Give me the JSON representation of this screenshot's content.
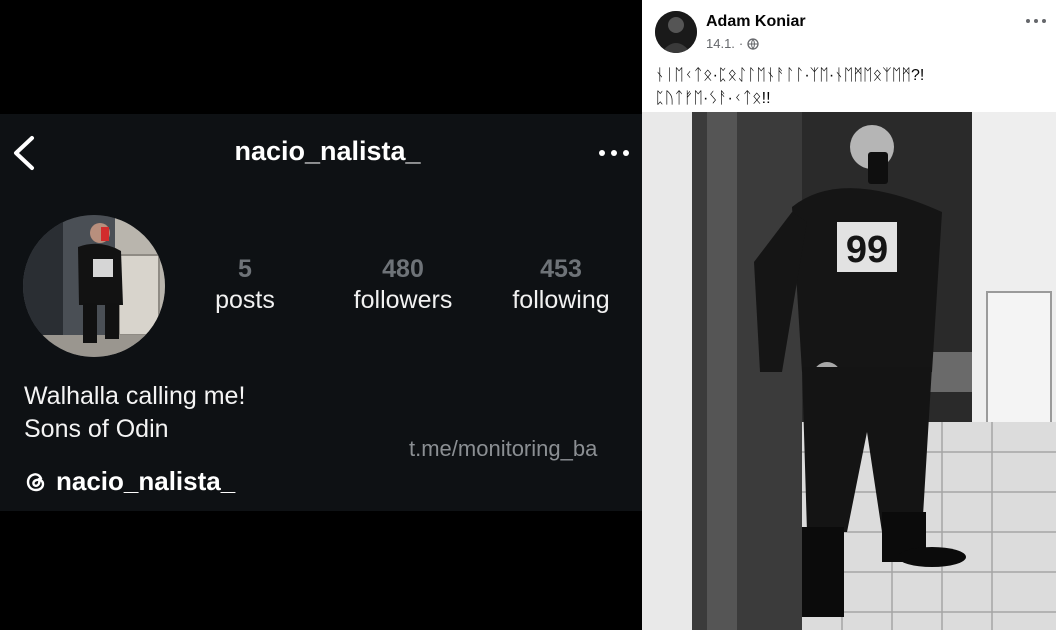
{
  "instagram": {
    "username": "nacio_nalista_",
    "stats": [
      {
        "value": "5",
        "label": "posts"
      },
      {
        "value": "480",
        "label": "followers"
      },
      {
        "value": "453",
        "label": "following"
      }
    ],
    "bio_lines": [
      "Walhalla calling me!",
      "Sons of Odin"
    ],
    "threads_handle": "nacio_nalista_",
    "watermark": "t.me/monitoring_ba"
  },
  "facebook": {
    "author": "Adam Koniar",
    "date": "14.1.",
    "separator": "·",
    "post_lines": [
      "ᚾᛁᛖᚲᛏᛟ·ᛈᛟᛇᛚᛖᚾᚨᛚᛚ·ᛉᛖ·ᚾᛖᛗᛖᛟᛉᛖᛗ?!",
      "ᛈᚢᛏᚠᛖ·ᛊᚨ·ᚲᛏᛟ!!"
    ],
    "icons": {
      "visibility": "globe-icon",
      "menu": "more-icon"
    }
  },
  "icons": {
    "back": "chevron-left-icon",
    "menu": "more-icon",
    "threads": "threads-icon"
  },
  "colors": {
    "ig_bg": "#0e1114",
    "fb_bg": "#ffffff",
    "muted": "#6e7378"
  }
}
